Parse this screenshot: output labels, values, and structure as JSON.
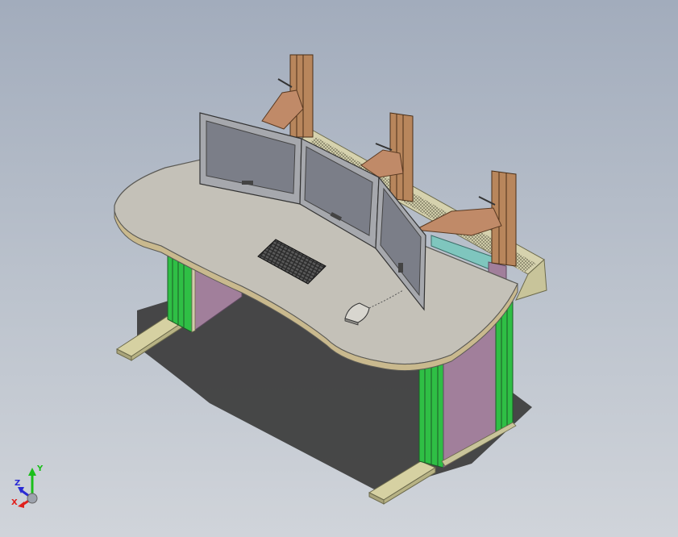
{
  "triad": {
    "x_label": "X",
    "y_label": "Y",
    "z_label": "Z"
  },
  "colors": {
    "background": "#b2bac6",
    "desktop": "#c4c1b8",
    "leg_panel": "#a17f9b",
    "leg_stripe": "#2ec445",
    "foot": "#c8c49a",
    "monitor_frame": "#a6a8ad",
    "monitor_screen": "#7b7e88",
    "mount_arm": "#c08a68",
    "pole": "#8a5a35",
    "cable_tray": "#7fc6be",
    "axis_x": "#e0201c",
    "axis_y": "#1bbf1b",
    "axis_z": "#2a2ad4"
  },
  "components": [
    "desktop",
    "left-leg",
    "right-leg",
    "left-foot",
    "right-foot",
    "monitor-left",
    "monitor-center",
    "monitor-right",
    "monitor-arm-1",
    "monitor-arm-2",
    "monitor-arm-3",
    "keyboard",
    "mouse",
    "cable-tray",
    "shadow"
  ]
}
